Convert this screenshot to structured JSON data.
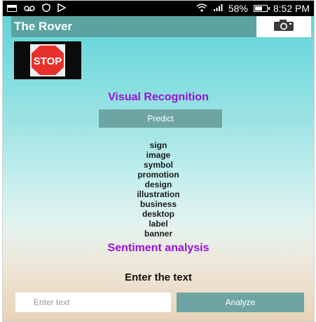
{
  "statusbar": {
    "icons_left": [
      "mail-icon",
      "voicemail-icon",
      "shield-icon",
      "play-store-icon"
    ],
    "icons_right": [
      "wifi-icon",
      "signal-icon",
      "battery-icon"
    ],
    "battery": "58%",
    "time": "8:52 PM"
  },
  "appbar": {
    "title": "The Rover",
    "camera_icon": "camera-icon"
  },
  "thumbnail": {
    "sign_text": "STOP"
  },
  "visual": {
    "title": "Visual Recognition",
    "predict_label": "Predict",
    "labels": [
      "sign",
      "image",
      "symbol",
      "promotion",
      "design",
      "illustration",
      "business",
      "desktop",
      "label",
      "banner"
    ]
  },
  "sentiment": {
    "title": "Sentiment analysis",
    "enter_label": "Enter the text",
    "input_placeholder": "Enter text",
    "input_value": "",
    "analyze_label": "Analyze"
  },
  "colors": {
    "accent_teal": "#5aa3a0",
    "button_teal": "#6ea5a2",
    "heading_purple": "#9a12d8",
    "stop_red": "#e8312a"
  }
}
